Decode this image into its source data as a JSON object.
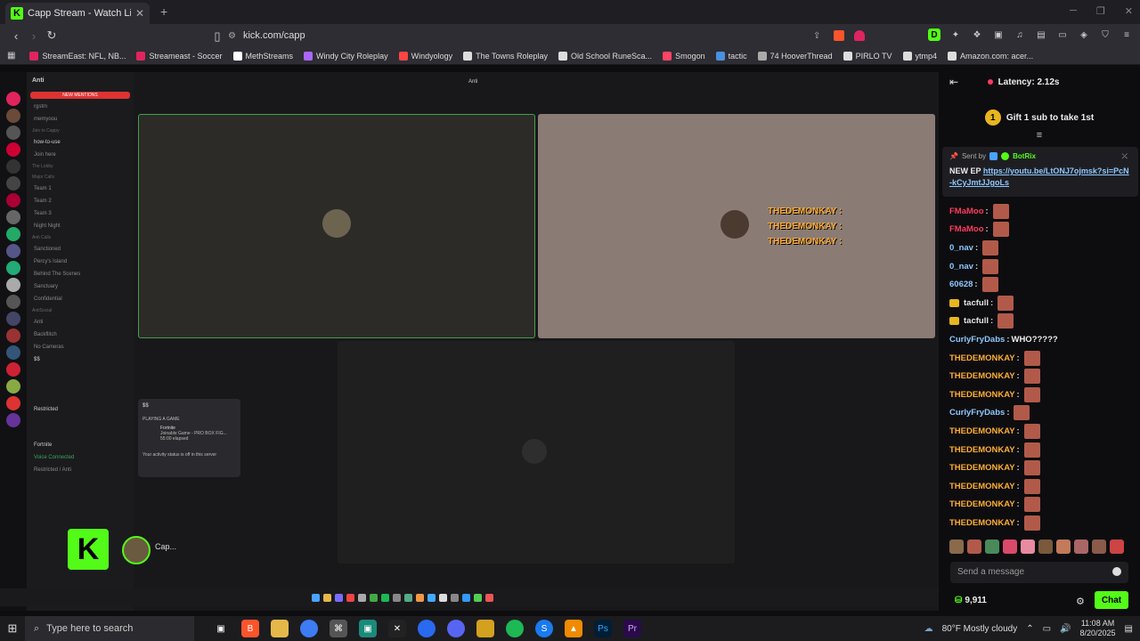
{
  "browser": {
    "tab_title": "Capp Stream - Watch Live on Kick",
    "url": "kick.com/capp",
    "bookmarks": [
      "StreamEast: NFL, NB...",
      "Streameast - Soccer",
      "MethStreams",
      "Windy City Roleplay",
      "Windyology",
      "The Towns Roleplay",
      "Old School RuneSca...",
      "Smogon",
      "tactic",
      "74 HooverThread",
      "PIRLO TV",
      "ytmp4",
      "Amazon.com: acer..."
    ],
    "bookmark_colors": [
      "#e0245e",
      "#e0245e",
      "#ffffff",
      "#aa66ff",
      "#ff4444",
      "#ffffff",
      "#ffffff",
      "#ff4466",
      "#4a90e2",
      "#aaaaaa",
      "#ffffff",
      "#ffffff",
      "#ffffff"
    ]
  },
  "stream": {
    "discord": {
      "server_name": "Anti",
      "new_mentions": "NEW MENTIONS",
      "channels": [
        "rgstm",
        "memyoou",
        "how-to-use",
        "Join here",
        "Team 1",
        "Team 2",
        "Team 3",
        "Night Night",
        "Sanctioned",
        "Percy's Island",
        "Behind The Scenes",
        "Sanctuary",
        "Confidential",
        "Anti",
        "Backflitch",
        "No Cameras",
        "$$",
        "Restricted"
      ],
      "categories": [
        "Join to Cappy",
        "The Lobby",
        "Major Calls",
        "Anti Calls",
        "AntiSocial"
      ],
      "voice_status": "Voice Connected",
      "voice_detail": "Restricted / Anti",
      "game": "Fortnite"
    },
    "call_title": "Anti",
    "overlay_lines": [
      "THEDEMONKAY :",
      "THEDEMONKAY :",
      "THEDEMONKAY :"
    ],
    "popup": {
      "title": "$$",
      "section": "PLAYING A GAME",
      "game": "Fortnite",
      "game_detail": "Joinable Game - PRO BOX FIG...",
      "elapsed": "55:00 elapsed",
      "footer": "Your activity status is off in this server"
    },
    "user_name": "Cap..."
  },
  "chat": {
    "latency": "Latency: 2.12s",
    "gift_count": "1",
    "gift_text": "Gift 1 sub to take 1st",
    "pinned_sent_by": "Sent by",
    "pinned_bot": "BotRix",
    "pinned_message": "NEW EP",
    "pinned_link": "https://youtu.be/LtONJ7ojmsk?si=PcN-kCyJmtJJgoLs",
    "messages": [
      {
        "user": "FMaMoo",
        "color": "#ff3b5c",
        "text": "",
        "emote": true
      },
      {
        "user": "FMaMoo",
        "color": "#ff3b5c",
        "text": "",
        "emote": true
      },
      {
        "user": "0_nav",
        "color": "#8ec8ff",
        "text": "",
        "emote": true
      },
      {
        "user": "0_nav",
        "color": "#8ec8ff",
        "text": "",
        "emote": true
      },
      {
        "user": "60628",
        "color": "#8ec8ff",
        "text": "",
        "emote": true
      },
      {
        "user": "tacfull",
        "color": "#e4e4e4",
        "text": "",
        "emote": true,
        "crown": true
      },
      {
        "user": "tacfull",
        "color": "#e4e4e4",
        "text": "",
        "emote": true,
        "crown": true
      },
      {
        "user": "CurlyFryDabs",
        "color": "#8ec8ff",
        "text": " WHO?????",
        "emote": false
      },
      {
        "user": "THEDEMONKAY",
        "color": "#ffad33",
        "text": "",
        "emote": true
      },
      {
        "user": "THEDEMONKAY",
        "color": "#ffad33",
        "text": "",
        "emote": true
      },
      {
        "user": "THEDEMONKAY",
        "color": "#ffad33",
        "text": "",
        "emote": true
      },
      {
        "user": "CurlyFryDabs",
        "color": "#8ec8ff",
        "text": "",
        "emote": true
      },
      {
        "user": "THEDEMONKAY",
        "color": "#ffad33",
        "text": "",
        "emote": true
      },
      {
        "user": "THEDEMONKAY",
        "color": "#ffad33",
        "text": "",
        "emote": true
      },
      {
        "user": "THEDEMONKAY",
        "color": "#ffad33",
        "text": "",
        "emote": true
      },
      {
        "user": "THEDEMONKAY",
        "color": "#ffad33",
        "text": "",
        "emote": true
      },
      {
        "user": "THEDEMONKAY",
        "color": "#ffad33",
        "text": "",
        "emote": true
      },
      {
        "user": "THEDEMONKAY",
        "color": "#ffad33",
        "text": "",
        "emote": true
      }
    ],
    "input_placeholder": "Send a message",
    "points": "9,911",
    "chat_button": "Chat"
  },
  "taskbar": {
    "search_placeholder": "Type here to search",
    "weather": "80°F  Mostly cloudy",
    "time": "11:08 AM",
    "date": "8/20/2025"
  },
  "colors": {
    "kick_green": "#53fc18",
    "name_orange": "#ffad33"
  }
}
